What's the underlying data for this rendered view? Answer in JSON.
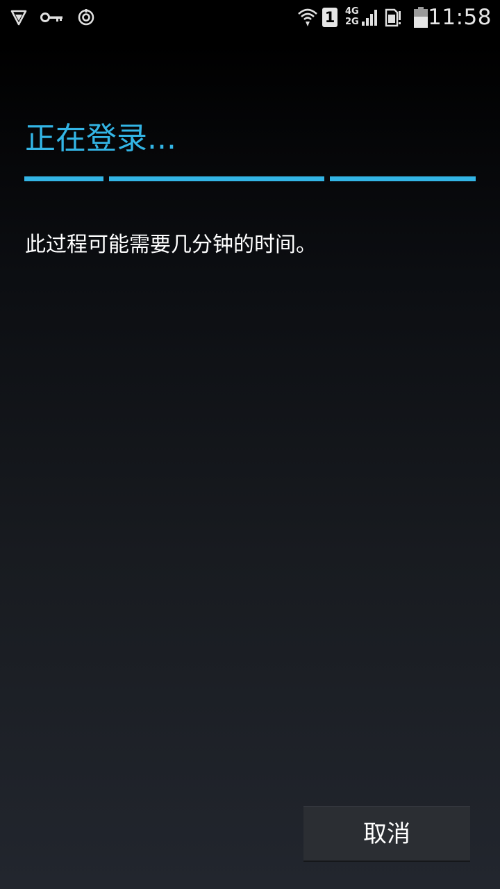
{
  "status_bar": {
    "time": "11:58",
    "sim_slot": "1",
    "network_top": "4G",
    "network_bottom": "2G",
    "icons": [
      "shield-icon",
      "key-icon",
      "sync-icon",
      "wifi-icon",
      "sim-slot-icon",
      "signal-icon",
      "sim-card-icon",
      "battery-icon"
    ]
  },
  "dialog": {
    "title": "正在登录...",
    "message": "此过程可能需要几分钟的时间。",
    "accent_color": "#33b5e5",
    "progress": "indeterminate",
    "cancel_label": "取消"
  }
}
